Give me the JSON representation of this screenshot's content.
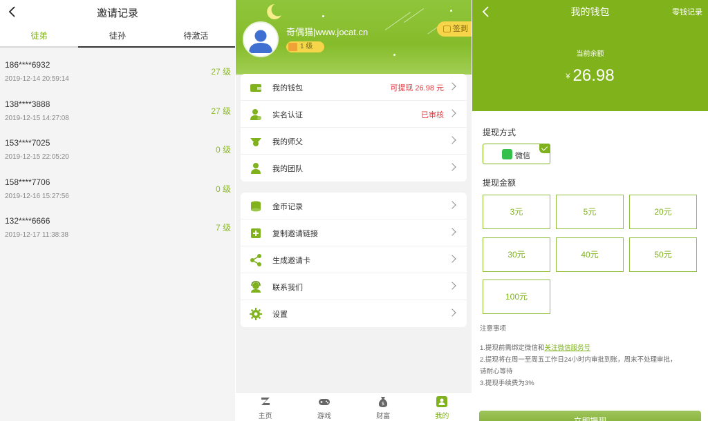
{
  "invite": {
    "title": "邀请记录",
    "tabs": [
      "徒弟",
      "徒孙",
      "待激活"
    ],
    "rows": [
      {
        "phone": "186****6932",
        "time": "2019-12-14 20:59:14",
        "level": "27 级"
      },
      {
        "phone": "138****3888",
        "time": "2019-12-15 14:27:08",
        "level": "27 级"
      },
      {
        "phone": "153****7025",
        "time": "2019-12-15 22:05:20",
        "level": "0 级"
      },
      {
        "phone": "158****7706",
        "time": "2019-12-16 15:27:56",
        "level": "0 级"
      },
      {
        "phone": "132****6666",
        "time": "2019-12-17 11:38:38",
        "level": "7 级"
      }
    ]
  },
  "profile": {
    "username": "奇偶猫|www.jocat.cn",
    "level_badge": "1 级",
    "checkin": "签到",
    "card1": [
      {
        "label": "我的钱包",
        "value": "可提现 26.98 元",
        "icon": "wallet-icon"
      },
      {
        "label": "实名认证",
        "value": "已审核",
        "icon": "user-verify-icon"
      },
      {
        "label": "我的师父",
        "value": "",
        "icon": "master-icon"
      },
      {
        "label": "我的团队",
        "value": "",
        "icon": "team-icon"
      }
    ],
    "card2": [
      {
        "label": "金币记录",
        "icon": "coins-icon"
      },
      {
        "label": "复制邀请链接",
        "icon": "copy-link-icon"
      },
      {
        "label": "生成邀请卡",
        "icon": "share-icon"
      },
      {
        "label": "联系我们",
        "icon": "support-icon"
      },
      {
        "label": "设置",
        "icon": "gear-icon"
      }
    ],
    "nav": [
      {
        "label": "主页",
        "icon": "home-icon"
      },
      {
        "label": "游戏",
        "icon": "gamepad-icon"
      },
      {
        "label": "财富",
        "icon": "money-bag-icon"
      },
      {
        "label": "我的",
        "icon": "me-icon"
      }
    ],
    "active_nav": 3
  },
  "wallet": {
    "title": "我的钱包",
    "record": "零钱记录",
    "balance_label": "当前余额",
    "currency": "¥",
    "balance": "26.98",
    "method_label": "提现方式",
    "method": "微信",
    "amount_label": "提现金额",
    "amounts": [
      "3元",
      "5元",
      "20元",
      "30元",
      "40元",
      "50元",
      "100元"
    ],
    "notes_title": "注意事项",
    "note1_pre": "1.提现前需绑定微信和",
    "note1_link": "关注微信服务号",
    "note2": "2.提现将在周一至周五工作日24小时内审批到账，周末不处理审批，",
    "note2b": "请耐心等待",
    "note3": "3.提现手续费为3%",
    "submit": "立即提现"
  },
  "colors": {
    "accent": "#7fb21d",
    "red": "#e0383e",
    "yellow": "#f7d54a"
  }
}
